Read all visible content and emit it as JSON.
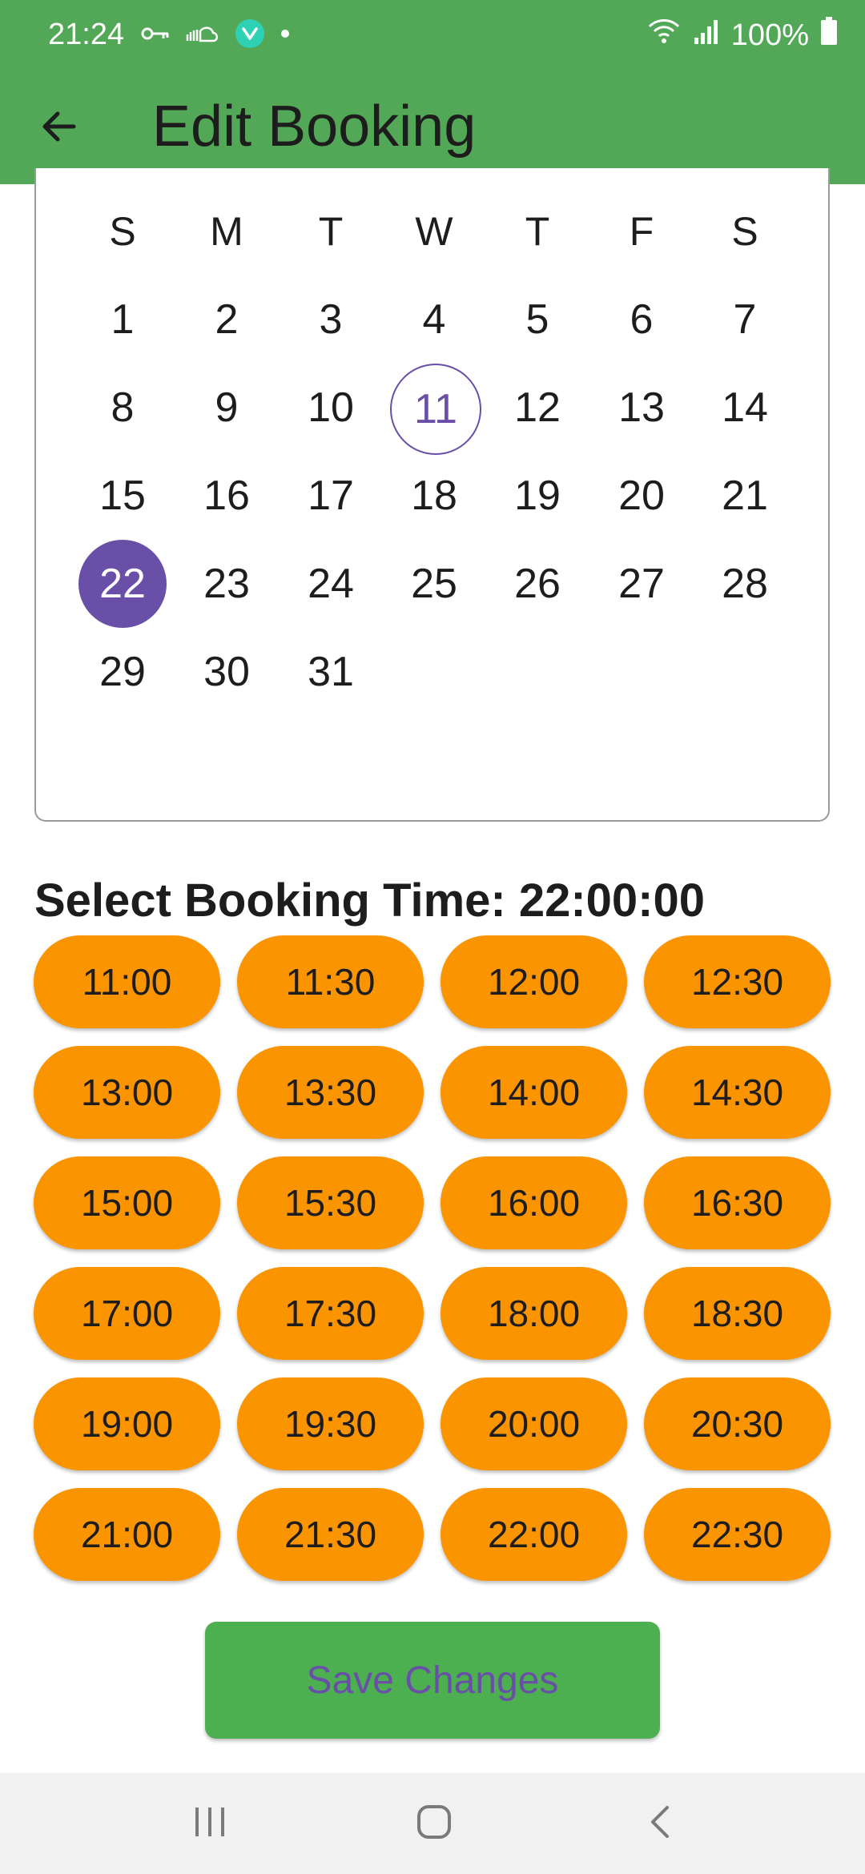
{
  "status_bar": {
    "time": "21:24",
    "battery": "100%",
    "icons_left": [
      "key-icon",
      "cloud-icon",
      "vpn-app-icon",
      "dot-icon"
    ],
    "icons_right": [
      "wifi-icon",
      "signal-icon",
      "battery-icon"
    ]
  },
  "app_bar": {
    "title": "Edit Booking",
    "back_icon": "arrow-left-icon",
    "color": "#52a856"
  },
  "calendar": {
    "weekdays": [
      "S",
      "M",
      "T",
      "W",
      "T",
      "F",
      "S"
    ],
    "weeks": [
      [
        "1",
        "2",
        "3",
        "4",
        "5",
        "6",
        "7"
      ],
      [
        "8",
        "9",
        "10",
        "11",
        "12",
        "13",
        "14"
      ],
      [
        "15",
        "16",
        "17",
        "18",
        "19",
        "20",
        "21"
      ],
      [
        "22",
        "23",
        "24",
        "25",
        "26",
        "27",
        "28"
      ],
      [
        "29",
        "30",
        "31"
      ]
    ],
    "today": "11",
    "selected": "22",
    "accent_color": "#6a4fa8"
  },
  "booking_time": {
    "heading": "Select Booking Time: 22:00:00",
    "button_color": "#fa9400",
    "slots": [
      "11:00",
      "11:30",
      "12:00",
      "12:30",
      "13:00",
      "13:30",
      "14:00",
      "14:30",
      "15:00",
      "15:30",
      "16:00",
      "16:30",
      "17:00",
      "17:30",
      "18:00",
      "18:30",
      "19:00",
      "19:30",
      "20:00",
      "20:30",
      "21:00",
      "21:30",
      "22:00",
      "22:30"
    ]
  },
  "save_button": {
    "label": "Save Changes",
    "color": "#4caf50"
  },
  "nav_bar": {
    "icons": [
      "recent-apps-icon",
      "home-icon",
      "back-icon"
    ]
  }
}
